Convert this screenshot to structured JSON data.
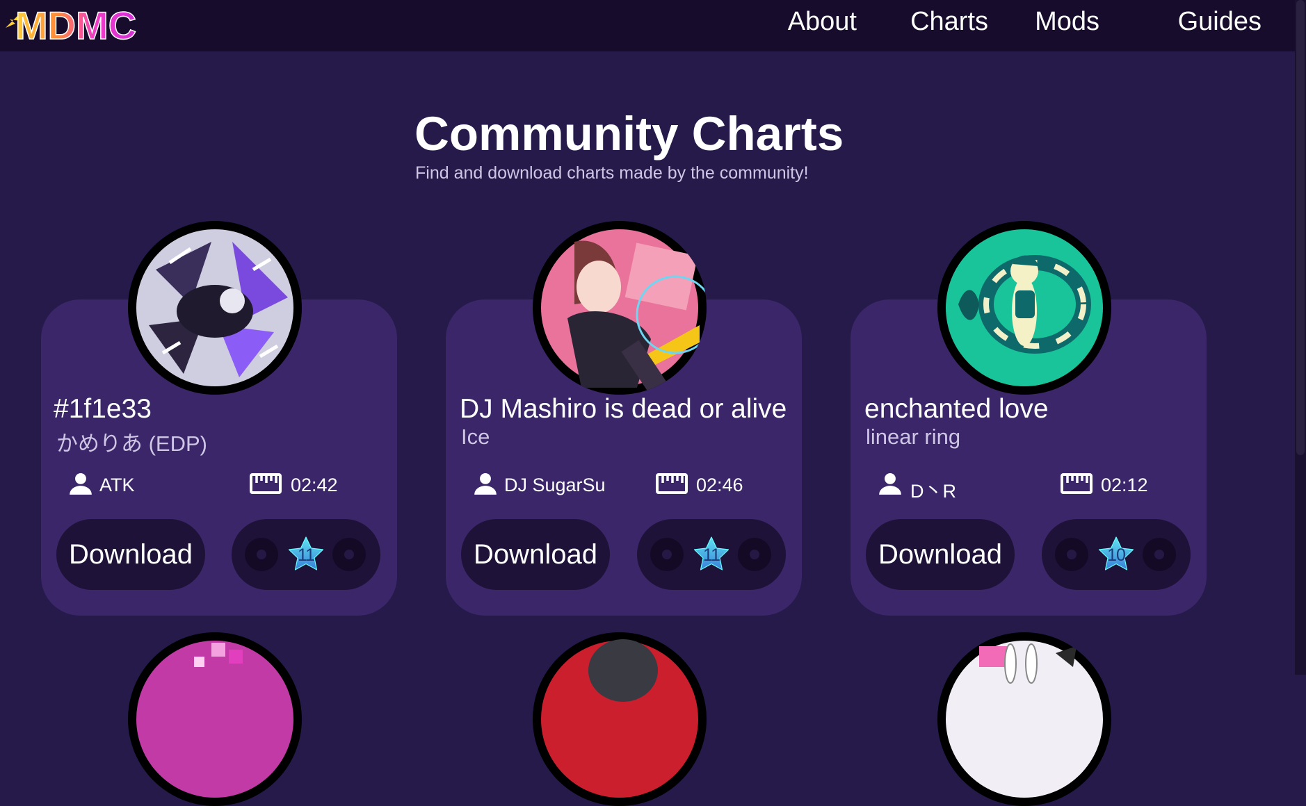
{
  "brand": {
    "logo_text": "MDMC"
  },
  "nav": {
    "items": [
      {
        "label": "About"
      },
      {
        "label": "Charts"
      },
      {
        "label": "Mods"
      },
      {
        "label": "Guides"
      }
    ]
  },
  "header": {
    "title": "Community Charts",
    "subtitle": "Find and download charts made by the community!"
  },
  "charts": [
    {
      "title": "#1f1e33",
      "artist": "かめりあ (EDP)",
      "charter": "ATK",
      "length": "02:42",
      "download_label": "Download",
      "level": "11",
      "cover_icon": "cover-art-dark-abstract"
    },
    {
      "title": "DJ Mashiro is dead or alive",
      "artist": "Ice",
      "charter": "DJ SugarSu",
      "length": "02:46",
      "download_label": "Download",
      "level": "11",
      "cover_icon": "cover-art-pink-character"
    },
    {
      "title": "enchanted love",
      "artist": "linear ring",
      "charter": "D丶R",
      "length": "02:12",
      "download_label": "Download",
      "level": "10",
      "cover_icon": "cover-art-teal-character"
    }
  ],
  "icons": {
    "charter": "user-icon",
    "length": "ruler-icon",
    "difficulty": "star-icon"
  },
  "colors": {
    "page_bg": "#251a4a",
    "navbar_bg": "#170c2b",
    "card_bg": "#3a2668",
    "button_bg": "#1e1238",
    "subtext": "#cfc6e6",
    "star_gradient_top": "#5fe3f2",
    "star_gradient_bottom": "#3a7fd8"
  }
}
